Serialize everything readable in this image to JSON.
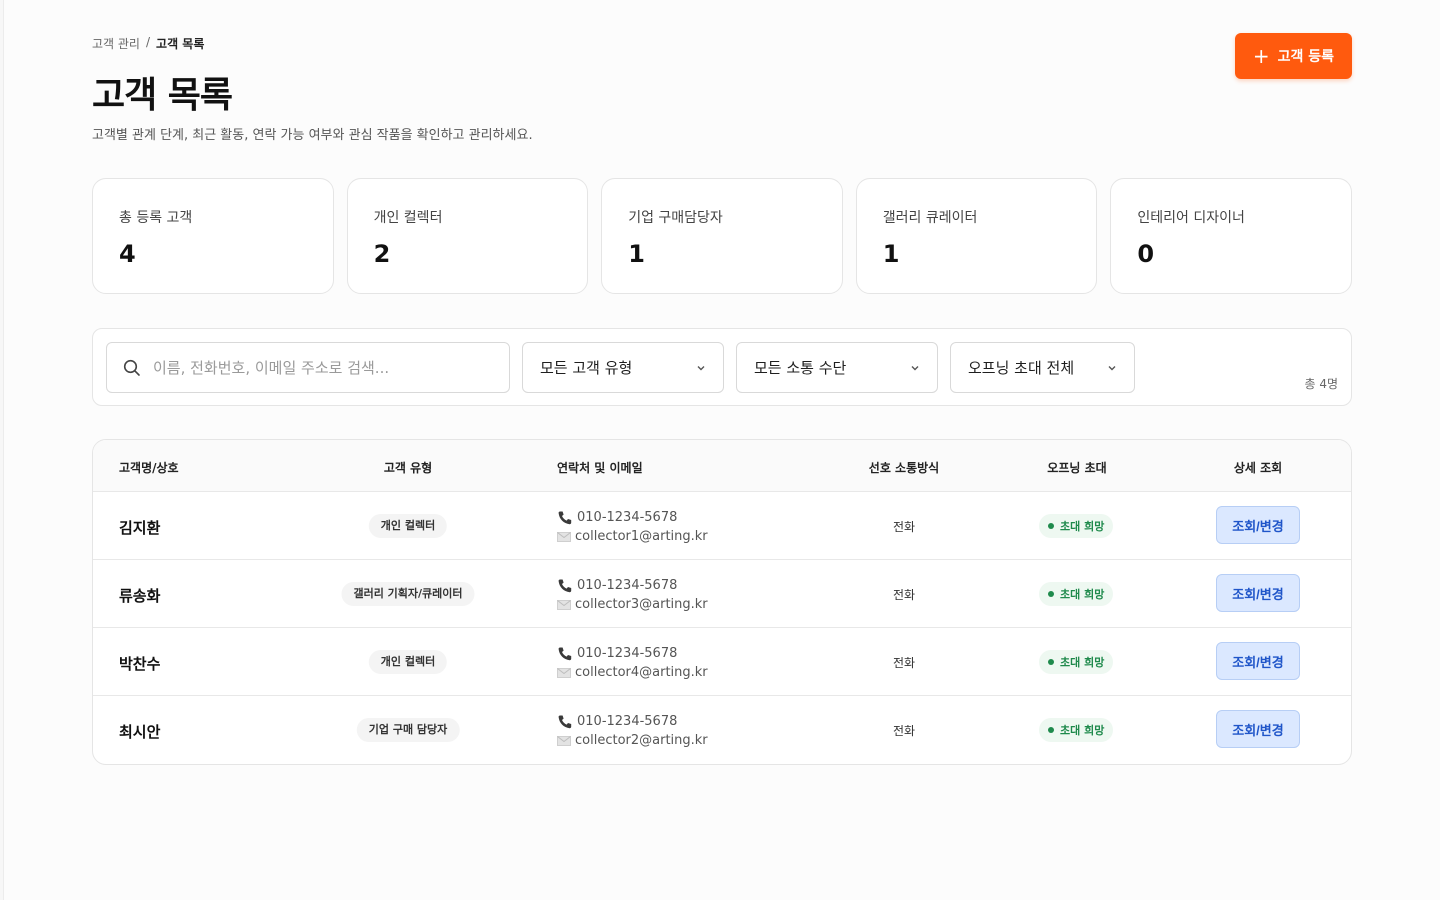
{
  "breadcrumb": {
    "parent": "고객 관리",
    "separator": "/",
    "current": "고객 목록"
  },
  "header": {
    "title": "고객 목록",
    "subtitle": "고객별 관계 단계, 최근 활동, 연락 가능 여부와 관심 작품을 확인하고 관리하세요.",
    "add_button": "고객 등록"
  },
  "stats": [
    {
      "label": "총 등록 고객",
      "value": "4"
    },
    {
      "label": "개인 컬렉터",
      "value": "2"
    },
    {
      "label": "기업 구매담당자",
      "value": "1"
    },
    {
      "label": "갤러리 큐레이터",
      "value": "1"
    },
    {
      "label": "인테리어 디자이너",
      "value": "0"
    }
  ],
  "filters": {
    "search_placeholder": "이름, 전화번호, 이메일 주소로 검색...",
    "type_select": "모든 고객 유형",
    "channel_select": "모든 소통 수단",
    "invite_select": "오프닝 초대 전체",
    "total": "총 4명"
  },
  "table": {
    "headers": {
      "name": "고객명/상호",
      "type": "고객 유형",
      "contact": "연락처 및 이메일",
      "preference": "선호 소통방식",
      "invite": "오프닝 초대",
      "detail": "상세 조회"
    },
    "rows": [
      {
        "name": "김지환",
        "type": "개인 컬렉터",
        "phone": "010-1234-5678",
        "email": "collector1@arting.kr",
        "preference": "전화",
        "invite": "초대 희망",
        "action": "조회/변경"
      },
      {
        "name": "류송화",
        "type": "갤러리 기획자/큐레이터",
        "phone": "010-1234-5678",
        "email": "collector3@arting.kr",
        "preference": "전화",
        "invite": "초대 희망",
        "action": "조회/변경"
      },
      {
        "name": "박찬수",
        "type": "개인 컬렉터",
        "phone": "010-1234-5678",
        "email": "collector4@arting.kr",
        "preference": "전화",
        "invite": "초대 희망",
        "action": "조회/변경"
      },
      {
        "name": "최시안",
        "type": "기업 구매 담당자",
        "phone": "010-1234-5678",
        "email": "collector2@arting.kr",
        "preference": "전화",
        "invite": "초대 희망",
        "action": "조회/변경"
      }
    ]
  },
  "colors": {
    "accent": "#ff5a0e",
    "invite_green": "#1f8a4c",
    "action_blue": "#1f55c9"
  },
  "icons": {
    "add": "plus-icon",
    "search": "search-icon",
    "dropdown": "chevron-down-icon",
    "phone": "phone-icon",
    "email": "mail-icon"
  }
}
